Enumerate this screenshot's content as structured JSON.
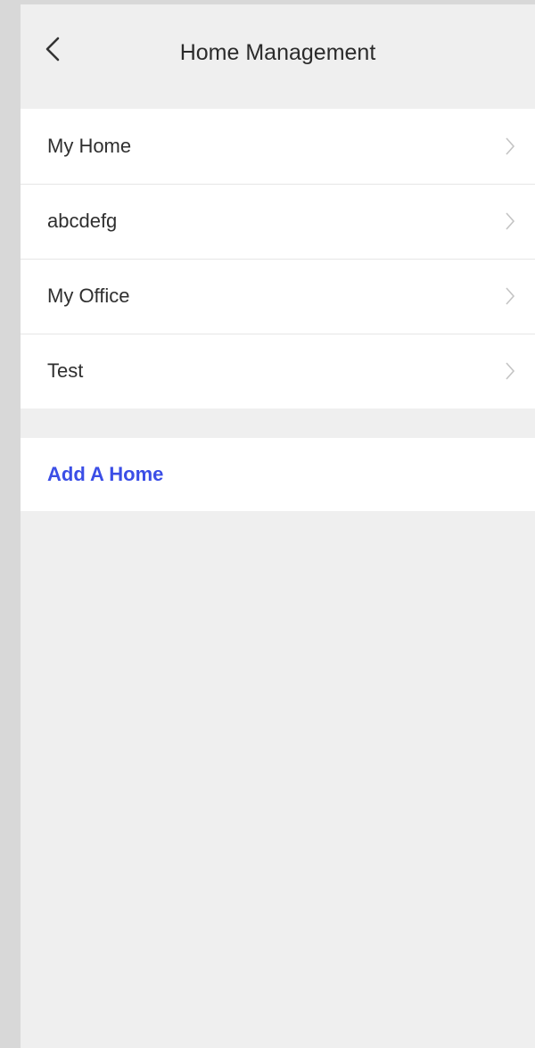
{
  "header": {
    "title": "Home Management",
    "back_icon": "chevron-left-icon"
  },
  "homes": {
    "items": [
      {
        "label": "My Home"
      },
      {
        "label": "abcdefg"
      },
      {
        "label": "My Office"
      },
      {
        "label": "Test"
      }
    ],
    "row_icon": "chevron-right-icon"
  },
  "actions": {
    "add_home_label": "Add A Home"
  },
  "colors": {
    "accent": "#3b4ee6",
    "background": "#efefef",
    "card": "#ffffff",
    "chevron": "#c4c4c4"
  }
}
